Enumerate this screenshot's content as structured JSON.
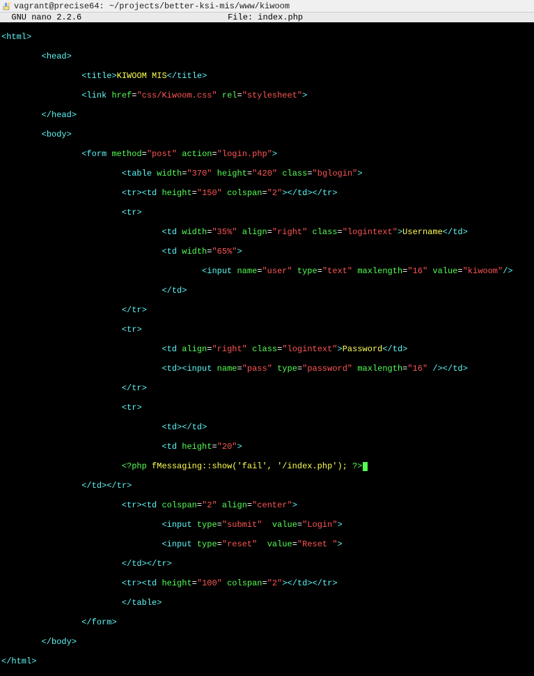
{
  "window": {
    "title": "vagrant@precise64: ~/projects/better-ksi-mis/www/kiwoom"
  },
  "nano": {
    "app": "  GNU nano 2.2.6",
    "file_label": "File: index.php"
  },
  "code": {
    "l00a": "<",
    "l00b": "html",
    "l00c": ">",
    "l01_pad": "        ",
    "l01a": "<",
    "l01b": "head",
    "l01c": ">",
    "l02_pad": "                ",
    "l02a": "<",
    "l02b": "title",
    "l02c": ">",
    "l02d": "KIWOOM MIS",
    "l02e": "</",
    "l02f": "title",
    "l02g": ">",
    "l03_pad": "                ",
    "l03a": "<",
    "l03b": "link ",
    "l03c": "href",
    "l03d": "=",
    "l03e": "\"css/Kiwoom.css\"",
    "l03f": " ",
    "l03g": "rel",
    "l03h": "=",
    "l03i": "\"stylesheet\"",
    "l03j": ">",
    "l04_pad": "        ",
    "l04a": "</",
    "l04b": "head",
    "l04c": ">",
    "l05_pad": "        ",
    "l05a": "<",
    "l05b": "body",
    "l05c": ">",
    "l06_pad": "                ",
    "l06a": "<",
    "l06b": "form ",
    "l06c": "method",
    "l06d": "=",
    "l06e": "\"post\"",
    "l06f": " ",
    "l06g": "action",
    "l06h": "=",
    "l06i": "\"login.php\"",
    "l06j": ">",
    "l07_pad": "                        ",
    "l07a": "<",
    "l07b": "table ",
    "l07c": "width",
    "l07d": "=",
    "l07e": "\"370\"",
    "l07f": " ",
    "l07g": "height",
    "l07h": "=",
    "l07i": "\"420\"",
    "l07j": " ",
    "l07k": "class",
    "l07l": "=",
    "l07m": "\"bglogin\"",
    "l07n": ">",
    "l08_pad": "                        ",
    "l08a": "<",
    "l08b": "tr",
    "l08c": "><",
    "l08d": "td ",
    "l08e": "height",
    "l08f": "=",
    "l08g": "\"150\"",
    "l08h": " ",
    "l08i": "colspan",
    "l08j": "=",
    "l08k": "\"2\"",
    "l08l": "></",
    "l08m": "td",
    "l08n": "></",
    "l08o": "tr",
    "l08p": ">",
    "l09_pad": "                        ",
    "l09a": "<",
    "l09b": "tr",
    "l09c": ">",
    "l10_pad": "                                ",
    "l10a": "<",
    "l10b": "td ",
    "l10c": "width",
    "l10d": "=",
    "l10e": "\"35%\"",
    "l10f": " ",
    "l10g": "align",
    "l10h": "=",
    "l10i": "\"right\"",
    "l10j": " ",
    "l10k": "class",
    "l10l": "=",
    "l10m": "\"logintext\"",
    "l10n": ">",
    "l10o": "Username",
    "l10p": "</",
    "l10q": "td",
    "l10r": ">",
    "l11_pad": "                                ",
    "l11a": "<",
    "l11b": "td ",
    "l11c": "width",
    "l11d": "=",
    "l11e": "\"65%\"",
    "l11f": ">",
    "l12_pad": "                                        ",
    "l12a": "<",
    "l12b": "input ",
    "l12c": "name",
    "l12d": "=",
    "l12e": "\"user\"",
    "l12f": " ",
    "l12g": "type",
    "l12h": "=",
    "l12i": "\"text\"",
    "l12j": " ",
    "l12k": "maxlength",
    "l12l": "=",
    "l12m": "\"16\"",
    "l12n": " ",
    "l12o": "value",
    "l12p": "=",
    "l12q": "\"kiwoom\"",
    "l12r": "/>",
    "l13_pad": "                                ",
    "l13a": "</",
    "l13b": "td",
    "l13c": ">",
    "l14_pad": "                        ",
    "l14a": "</",
    "l14b": "tr",
    "l14c": ">",
    "l15_pad": "                        ",
    "l15a": "<",
    "l15b": "tr",
    "l15c": ">",
    "l16_pad": "                                ",
    "l16a": "<",
    "l16b": "td ",
    "l16c": "align",
    "l16d": "=",
    "l16e": "\"right\"",
    "l16f": " ",
    "l16g": "class",
    "l16h": "=",
    "l16i": "\"logintext\"",
    "l16j": ">",
    "l16k": "Password",
    "l16l": "</",
    "l16m": "td",
    "l16n": ">",
    "l17_pad": "                                ",
    "l17a": "<",
    "l17b": "td",
    "l17c": "><",
    "l17d": "input ",
    "l17e": "name",
    "l17f": "=",
    "l17g": "\"pass\"",
    "l17h": " ",
    "l17i": "type",
    "l17j": "=",
    "l17k": "\"password\"",
    "l17l": " ",
    "l17m": "maxlength",
    "l17n": "=",
    "l17o": "\"16\"",
    "l17p": " ",
    "l17q": "/></",
    "l17r": "td",
    "l17s": ">",
    "l18_pad": "                        ",
    "l18a": "</",
    "l18b": "tr",
    "l18c": ">",
    "l19_pad": "                        ",
    "l19a": "<",
    "l19b": "tr",
    "l19c": ">",
    "l20_pad": "                                ",
    "l20a": "<",
    "l20b": "td",
    "l20c": "></",
    "l20d": "td",
    "l20e": ">",
    "l21_pad": "                                ",
    "l21a": "<",
    "l21b": "td ",
    "l21c": "height",
    "l21d": "=",
    "l21e": "\"20\"",
    "l21f": ">",
    "l22_pad": "                        ",
    "l22a": "<?php",
    "l22b": " ",
    "l22c": "fMessaging::show('fail', '/index.php'); ",
    "l22d": "?>",
    "l23_pad": "                ",
    "l23a": "</",
    "l23b": "td",
    "l23c": "></",
    "l23d": "tr",
    "l23e": ">",
    "l24_pad": "                        ",
    "l24a": "<",
    "l24b": "tr",
    "l24c": "><",
    "l24d": "td ",
    "l24e": "colspan",
    "l24f": "=",
    "l24g": "\"2\"",
    "l24h": " ",
    "l24i": "align",
    "l24j": "=",
    "l24k": "\"center\"",
    "l24l": ">",
    "l25_pad": "                                ",
    "l25a": "<",
    "l25b": "input ",
    "l25c": "type",
    "l25d": "=",
    "l25e": "\"submit\"",
    "l25f": "  ",
    "l25g": "value",
    "l25h": "=",
    "l25i": "\"Login\"",
    "l25j": ">",
    "l26_pad": "                                ",
    "l26a": "<",
    "l26b": "input ",
    "l26c": "type",
    "l26d": "=",
    "l26e": "\"reset\"",
    "l26f": "  ",
    "l26g": "value",
    "l26h": "=",
    "l26i": "\"Reset \"",
    "l26j": ">",
    "l27_pad": "                        ",
    "l27a": "</",
    "l27b": "td",
    "l27c": "></",
    "l27d": "tr",
    "l27e": ">",
    "l28_pad": "                        ",
    "l28a": "<",
    "l28b": "tr",
    "l28c": "><",
    "l28d": "td ",
    "l28e": "height",
    "l28f": "=",
    "l28g": "\"100\"",
    "l28h": " ",
    "l28i": "colspan",
    "l28j": "=",
    "l28k": "\"2\"",
    "l28l": "></",
    "l28m": "td",
    "l28n": "></",
    "l28o": "tr",
    "l28p": ">",
    "l29_pad": "                        ",
    "l29a": "</",
    "l29b": "table",
    "l29c": ">",
    "l30_pad": "                ",
    "l30a": "</",
    "l30b": "form",
    "l30c": ">",
    "l31_pad": "        ",
    "l31a": "</",
    "l31b": "body",
    "l31c": ">",
    "l32a": "</",
    "l32b": "html",
    "l32c": ">"
  }
}
